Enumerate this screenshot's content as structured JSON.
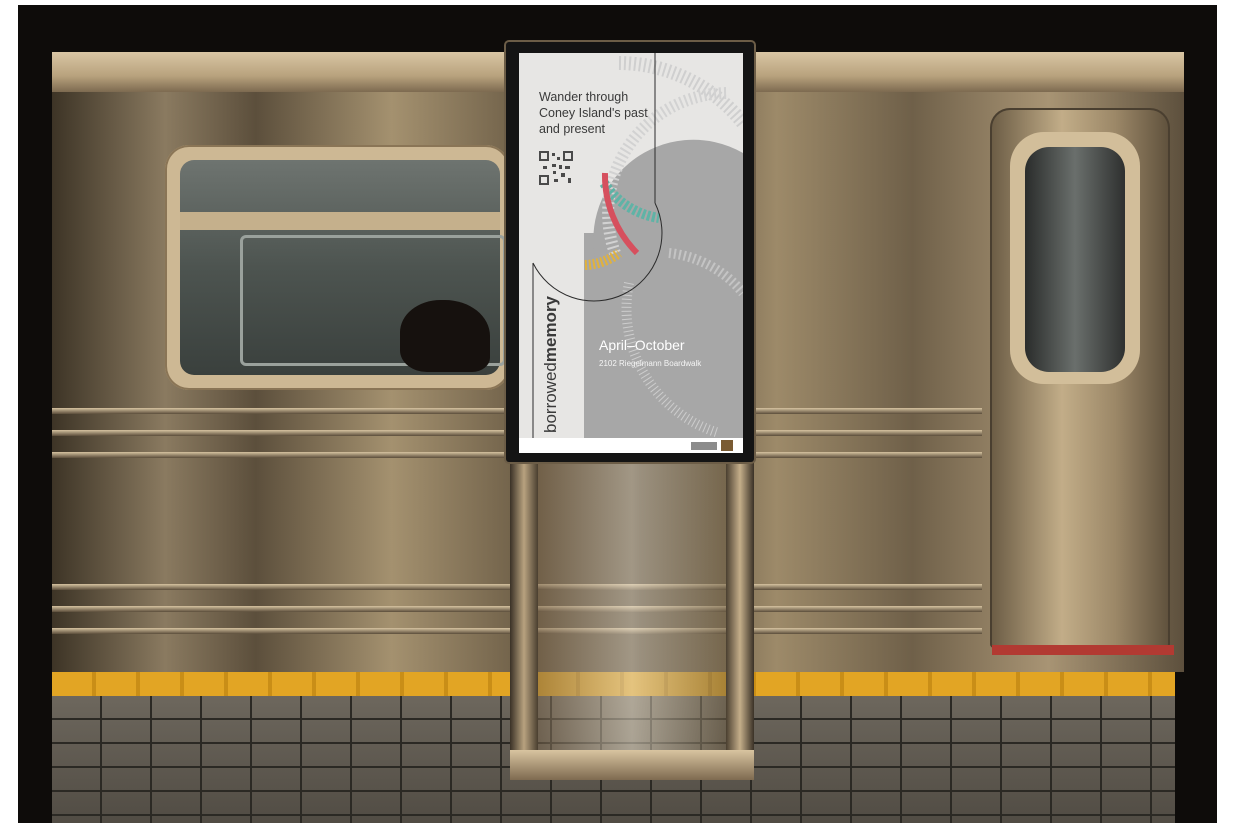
{
  "poster": {
    "tagline_lines": [
      "Wander through",
      "Coney Island's past",
      "and present"
    ],
    "title_light": "borrowed",
    "title_bold": "memory",
    "dates": "April–October",
    "address": "2102 Riegelmann Boardwalk"
  },
  "colors": {
    "platform_edge": "#e2a524",
    "door_sill": "#b23a32",
    "poster_bg": "#e7e6e4",
    "poster_gray": "#a7a7a7",
    "accent_teal": "#5fb3a6",
    "accent_red": "#d6505e",
    "accent_yellow": "#e1b23c"
  },
  "icons": [
    "qr-code-icon",
    "footer-logo-icon"
  ]
}
